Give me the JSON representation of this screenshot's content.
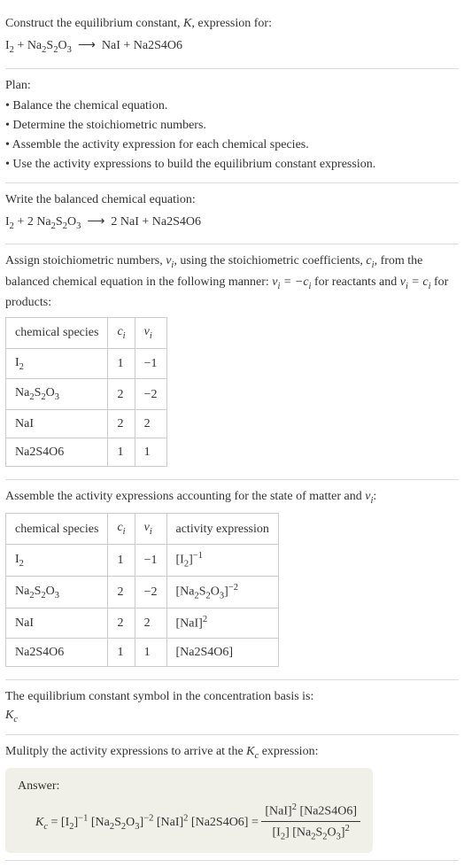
{
  "intro": {
    "line1": "Construct the equilibrium constant, ",
    "k": "K",
    "line1b": ", expression for:",
    "eq_lhs": "I₂ + Na₂S₂O₃",
    "arrow": "⟶",
    "eq_rhs": "NaI + Na2S4O6"
  },
  "plan": {
    "title": "Plan:",
    "items": [
      "• Balance the chemical equation.",
      "• Determine the stoichiometric numbers.",
      "• Assemble the activity expression for each chemical species.",
      "• Use the activity expressions to build the equilibrium constant expression."
    ]
  },
  "balanced": {
    "title": "Write the balanced chemical equation:",
    "lhs": "I₂ + 2 Na₂S₂O₃",
    "arrow": "⟶",
    "rhs": "2 NaI + Na2S4O6"
  },
  "stoich": {
    "line1a": "Assign stoichiometric numbers, ",
    "nu": "ν",
    "sub_i": "i",
    "line1b": ", using the stoichiometric coefficients, ",
    "c": "c",
    "line1c": ", from the balanced chemical equation in the following manner: ",
    "rel1": "νᵢ = −cᵢ",
    "line1d": " for reactants and ",
    "rel2": "νᵢ = cᵢ",
    "line1e": " for products:",
    "headers": [
      "chemical species",
      "cᵢ",
      "νᵢ"
    ],
    "rows": [
      {
        "sp": "I₂",
        "c": "1",
        "v": "−1"
      },
      {
        "sp": "Na₂S₂O₃",
        "c": "2",
        "v": "−2"
      },
      {
        "sp": "NaI",
        "c": "2",
        "v": "2"
      },
      {
        "sp": "Na2S4O6",
        "c": "1",
        "v": "1"
      }
    ]
  },
  "activity": {
    "title": "Assemble the activity expressions accounting for the state of matter and νᵢ:",
    "headers": [
      "chemical species",
      "cᵢ",
      "νᵢ",
      "activity expression"
    ],
    "rows": [
      {
        "sp": "I₂",
        "c": "1",
        "v": "−1",
        "a": "[I₂]⁻¹"
      },
      {
        "sp": "Na₂S₂O₃",
        "c": "2",
        "v": "−2",
        "a": "[Na₂S₂O₃]⁻²"
      },
      {
        "sp": "NaI",
        "c": "2",
        "v": "2",
        "a": "[NaI]²"
      },
      {
        "sp": "Na2S4O6",
        "c": "1",
        "v": "1",
        "a": "[Na2S4O6]"
      }
    ]
  },
  "symbol": {
    "line": "The equilibrium constant symbol in the concentration basis is:",
    "kc": "K",
    "sub": "c"
  },
  "multiply": {
    "line": "Mulitply the activity expressions to arrive at the ",
    "kc": "K",
    "sub": "c",
    "line2": " expression:"
  },
  "answer": {
    "label": "Answer:",
    "kc": "K",
    "sub": "c",
    "eq": " = [I₂]⁻¹ [Na₂S₂O₃]⁻² [NaI]² [Na2S4O6] = ",
    "num": "[NaI]² [Na2S4O6]",
    "den": "[I₂] [Na₂S₂O₃]²"
  }
}
